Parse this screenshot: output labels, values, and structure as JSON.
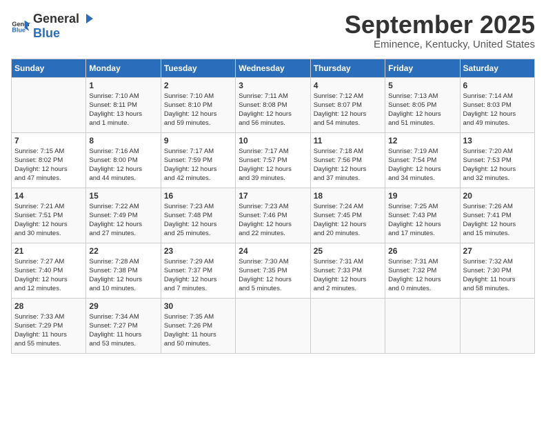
{
  "logo": {
    "general": "General",
    "blue": "Blue"
  },
  "header": {
    "month": "September 2025",
    "location": "Eminence, Kentucky, United States"
  },
  "weekdays": [
    "Sunday",
    "Monday",
    "Tuesday",
    "Wednesday",
    "Thursday",
    "Friday",
    "Saturday"
  ],
  "weeks": [
    [
      {
        "day": "",
        "content": ""
      },
      {
        "day": "1",
        "content": "Sunrise: 7:10 AM\nSunset: 8:11 PM\nDaylight: 13 hours\nand 1 minute."
      },
      {
        "day": "2",
        "content": "Sunrise: 7:10 AM\nSunset: 8:10 PM\nDaylight: 12 hours\nand 59 minutes."
      },
      {
        "day": "3",
        "content": "Sunrise: 7:11 AM\nSunset: 8:08 PM\nDaylight: 12 hours\nand 56 minutes."
      },
      {
        "day": "4",
        "content": "Sunrise: 7:12 AM\nSunset: 8:07 PM\nDaylight: 12 hours\nand 54 minutes."
      },
      {
        "day": "5",
        "content": "Sunrise: 7:13 AM\nSunset: 8:05 PM\nDaylight: 12 hours\nand 51 minutes."
      },
      {
        "day": "6",
        "content": "Sunrise: 7:14 AM\nSunset: 8:03 PM\nDaylight: 12 hours\nand 49 minutes."
      }
    ],
    [
      {
        "day": "7",
        "content": "Sunrise: 7:15 AM\nSunset: 8:02 PM\nDaylight: 12 hours\nand 47 minutes."
      },
      {
        "day": "8",
        "content": "Sunrise: 7:16 AM\nSunset: 8:00 PM\nDaylight: 12 hours\nand 44 minutes."
      },
      {
        "day": "9",
        "content": "Sunrise: 7:17 AM\nSunset: 7:59 PM\nDaylight: 12 hours\nand 42 minutes."
      },
      {
        "day": "10",
        "content": "Sunrise: 7:17 AM\nSunset: 7:57 PM\nDaylight: 12 hours\nand 39 minutes."
      },
      {
        "day": "11",
        "content": "Sunrise: 7:18 AM\nSunset: 7:56 PM\nDaylight: 12 hours\nand 37 minutes."
      },
      {
        "day": "12",
        "content": "Sunrise: 7:19 AM\nSunset: 7:54 PM\nDaylight: 12 hours\nand 34 minutes."
      },
      {
        "day": "13",
        "content": "Sunrise: 7:20 AM\nSunset: 7:53 PM\nDaylight: 12 hours\nand 32 minutes."
      }
    ],
    [
      {
        "day": "14",
        "content": "Sunrise: 7:21 AM\nSunset: 7:51 PM\nDaylight: 12 hours\nand 30 minutes."
      },
      {
        "day": "15",
        "content": "Sunrise: 7:22 AM\nSunset: 7:49 PM\nDaylight: 12 hours\nand 27 minutes."
      },
      {
        "day": "16",
        "content": "Sunrise: 7:23 AM\nSunset: 7:48 PM\nDaylight: 12 hours\nand 25 minutes."
      },
      {
        "day": "17",
        "content": "Sunrise: 7:23 AM\nSunset: 7:46 PM\nDaylight: 12 hours\nand 22 minutes."
      },
      {
        "day": "18",
        "content": "Sunrise: 7:24 AM\nSunset: 7:45 PM\nDaylight: 12 hours\nand 20 minutes."
      },
      {
        "day": "19",
        "content": "Sunrise: 7:25 AM\nSunset: 7:43 PM\nDaylight: 12 hours\nand 17 minutes."
      },
      {
        "day": "20",
        "content": "Sunrise: 7:26 AM\nSunset: 7:41 PM\nDaylight: 12 hours\nand 15 minutes."
      }
    ],
    [
      {
        "day": "21",
        "content": "Sunrise: 7:27 AM\nSunset: 7:40 PM\nDaylight: 12 hours\nand 12 minutes."
      },
      {
        "day": "22",
        "content": "Sunrise: 7:28 AM\nSunset: 7:38 PM\nDaylight: 12 hours\nand 10 minutes."
      },
      {
        "day": "23",
        "content": "Sunrise: 7:29 AM\nSunset: 7:37 PM\nDaylight: 12 hours\nand 7 minutes."
      },
      {
        "day": "24",
        "content": "Sunrise: 7:30 AM\nSunset: 7:35 PM\nDaylight: 12 hours\nand 5 minutes."
      },
      {
        "day": "25",
        "content": "Sunrise: 7:31 AM\nSunset: 7:33 PM\nDaylight: 12 hours\nand 2 minutes."
      },
      {
        "day": "26",
        "content": "Sunrise: 7:31 AM\nSunset: 7:32 PM\nDaylight: 12 hours\nand 0 minutes."
      },
      {
        "day": "27",
        "content": "Sunrise: 7:32 AM\nSunset: 7:30 PM\nDaylight: 11 hours\nand 58 minutes."
      }
    ],
    [
      {
        "day": "28",
        "content": "Sunrise: 7:33 AM\nSunset: 7:29 PM\nDaylight: 11 hours\nand 55 minutes."
      },
      {
        "day": "29",
        "content": "Sunrise: 7:34 AM\nSunset: 7:27 PM\nDaylight: 11 hours\nand 53 minutes."
      },
      {
        "day": "30",
        "content": "Sunrise: 7:35 AM\nSunset: 7:26 PM\nDaylight: 11 hours\nand 50 minutes."
      },
      {
        "day": "",
        "content": ""
      },
      {
        "day": "",
        "content": ""
      },
      {
        "day": "",
        "content": ""
      },
      {
        "day": "",
        "content": ""
      }
    ]
  ]
}
